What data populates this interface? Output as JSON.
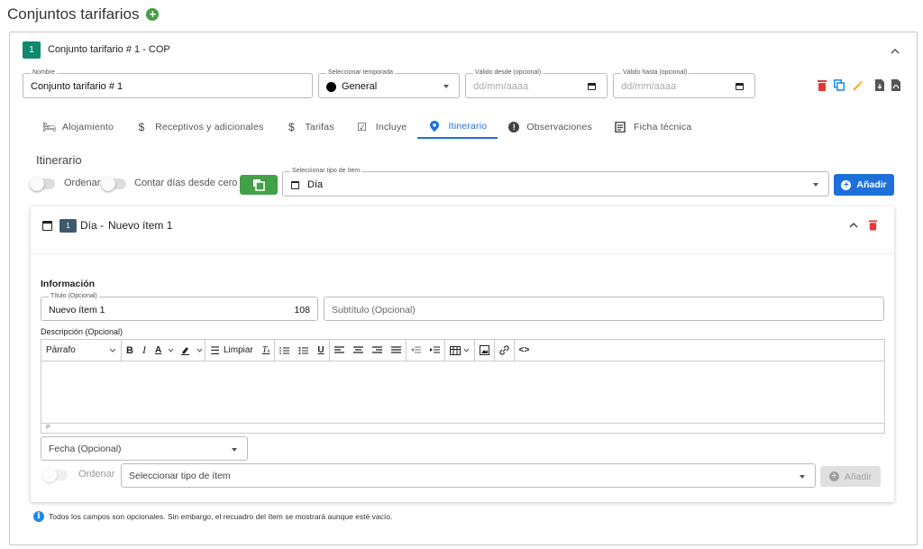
{
  "page": {
    "title": "Conjuntos tarifarios"
  },
  "set": {
    "number": "1",
    "title": "Conjunto tarifario # 1 - COP"
  },
  "form": {
    "name_label": "Nombre",
    "name_value": "Conjunto tarifario # 1",
    "season_label": "Seleccionar temporada",
    "season_value": "General",
    "from_label": "Válido desde (opcional)",
    "from_placeholder": "dd/mm/aaaa",
    "to_label": "Válido hasta (opcional)",
    "to_placeholder": "dd/mm/aaaa"
  },
  "colors": {
    "accent": "#1e6fd9",
    "green": "#43a047",
    "danger": "#e53935",
    "teal": "#0f8a6f"
  },
  "action_icons": [
    "trash-icon",
    "duplicate-icon",
    "magic-wand-icon",
    "file-export-icon",
    "pdf-icon"
  ],
  "tabs": [
    {
      "label": "Alojamiento",
      "icon": "bed-icon"
    },
    {
      "label": "Receptivos y adicionales",
      "icon": "dollar-icon"
    },
    {
      "label": "Tarifas",
      "icon": "dollar-icon"
    },
    {
      "label": "Incluye",
      "icon": "checkbox-icon"
    },
    {
      "label": "Itinerario",
      "icon": "location-pin-icon",
      "active": true
    },
    {
      "label": "Observaciones",
      "icon": "alert-circle-icon"
    },
    {
      "label": "Ficha técnica",
      "icon": "document-icon"
    }
  ],
  "itinerary": {
    "title": "Itinerario",
    "order_label": "Ordenar",
    "count_days_label": "Contar días desde cero",
    "type_label": "Seleccionar tipo de ítem",
    "type_value": "Día",
    "add_label": "Añadir"
  },
  "item": {
    "number": "1",
    "type": "Día -",
    "name": "Nuevo ítem 1",
    "info_heading": "Información",
    "title_label": "Título (Opcional)",
    "title_value": "Nuevo ítem 1",
    "title_remaining": "108",
    "subtitle_placeholder": "Subtítulo (Opcional)",
    "description_label": "Descripción (Opcional)",
    "editor": {
      "paragraph": "Párrafo",
      "clear_label": "Limpiar",
      "footer": "P"
    },
    "date_placeholder": "Fecha (Opcional)",
    "order_label": "Ordenar",
    "type_placeholder": "Seleccionar tipo de ítem",
    "add_label": "Añadir"
  },
  "footer_note": "Todos los campos son opcionales. Sin embargo, el recuadro del ítem se mostrará aunque esté vacío."
}
